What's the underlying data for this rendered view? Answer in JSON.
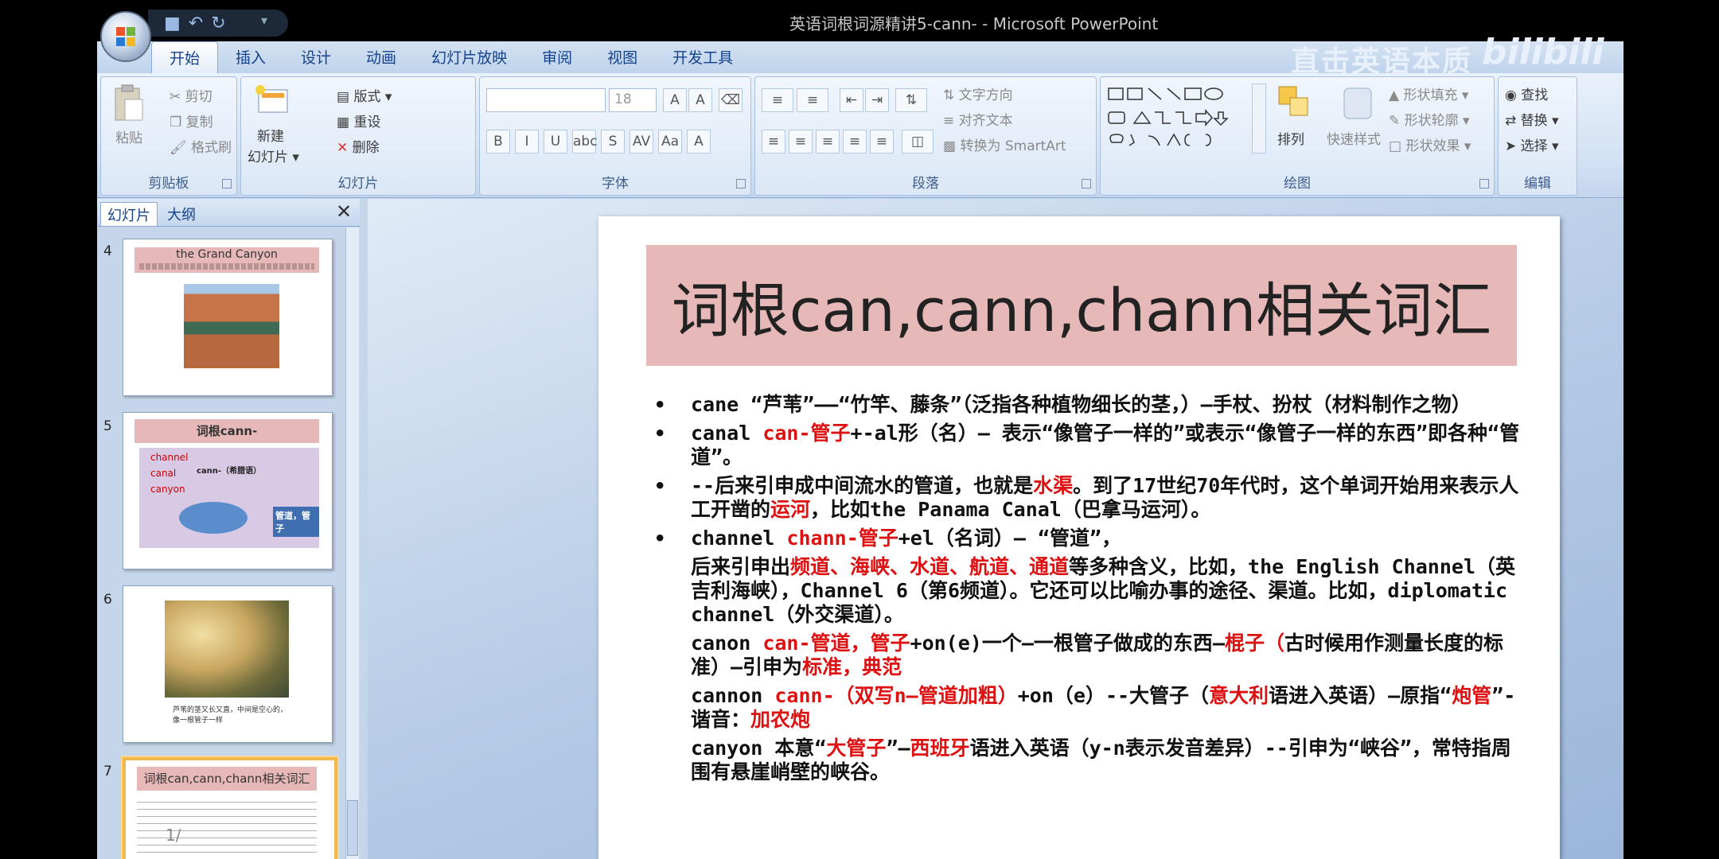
{
  "window": {
    "title": "英语词根词源精讲5-cann-  - Microsoft PowerPoint"
  },
  "ribbon_tabs": [
    "开始",
    "插入",
    "设计",
    "动画",
    "幻灯片放映",
    "审阅",
    "视图",
    "开发工具"
  ],
  "overlay": {
    "watermark": "直击英语本质",
    "bilibili": "bilibili"
  },
  "ribbon": {
    "clipboard": {
      "paste": "粘贴",
      "cut": "剪切",
      "copy": "复制",
      "format_painter": "格式刷",
      "label": "剪贴板"
    },
    "slides": {
      "new_slide": "新建",
      "new_slide2": "幻灯片",
      "layout": "版式",
      "reset": "重设",
      "delete": "删除",
      "label": "幻灯片"
    },
    "font": {
      "size": "18",
      "label": "字体",
      "buttons": [
        "B",
        "I",
        "U",
        "abc",
        "S",
        "AV",
        "Aa",
        "A"
      ]
    },
    "paragraph": {
      "text_direction": "文字方向",
      "align_text": "对齐文本",
      "smartart": "转换为 SmartArt",
      "label": "段落"
    },
    "drawing": {
      "arrange": "排列",
      "quick_styles": "快速样式",
      "shape_fill": "形状填充",
      "shape_outline": "形状轮廓",
      "shape_effects": "形状效果",
      "label": "绘图"
    },
    "editing": {
      "find": "查找",
      "replace": "替换",
      "select": "选择",
      "label": "编辑"
    }
  },
  "panel": {
    "tab_slides": "幻灯片",
    "tab_outline": "大纲"
  },
  "thumbnails": [
    {
      "num": "4",
      "title": "the Grand Canyon"
    },
    {
      "num": "5",
      "title": "词根cann-",
      "words": [
        "channel",
        "canal",
        "canyon"
      ],
      "root": "cann-（希腊语）",
      "box": "管道，管子"
    },
    {
      "num": "6",
      "caption": "芦苇的茎又长又直，中间是空心的，像一根管子一样"
    },
    {
      "num": "7",
      "title": "词根can,cann,chann相关词汇"
    }
  ],
  "slide": {
    "title": "词根can,cann,chann相关词汇",
    "bullets": [
      {
        "bullet": "•",
        "parts": [
          {
            "t": " cane “芦苇”——“竹竿、藤条”（泛指各种植物细长的茎，）—手杖、扮杖（材料制作之物）"
          }
        ]
      },
      {
        "bullet": "•",
        "parts": [
          {
            "t": " canal  "
          },
          {
            "t": "can-管子",
            "red": true
          },
          {
            "t": "+-al形（名）— 表示“像管子一样的”或表示“像管子一样的东西”即各种“管道”。"
          }
        ]
      },
      {
        "bullet": "•",
        "parts": [
          {
            "t": "--后来引申成中间流水的管道，也就是"
          },
          {
            "t": "水渠",
            "red": true
          },
          {
            "t": "。到了17世纪70年代时，这个单词开始用来表示人工开凿的"
          },
          {
            "t": "运河",
            "red": true
          },
          {
            "t": "，比如the Panama Canal（巴拿马运河）。"
          }
        ]
      },
      {
        "bullet": "•",
        "parts": [
          {
            "t": "channel "
          },
          {
            "t": "chann-管子",
            "red": true
          },
          {
            "t": "+el（名词）— “管道”，"
          }
        ]
      },
      {
        "bullet": "",
        "parts": [
          {
            "t": "  后来引申出"
          },
          {
            "t": "频道、海峡、水道、航道、通道",
            "red": true
          },
          {
            "t": "等多种含义，比如，the English Channel（英吉利海峡），Channel 6（第6频道）。它还可以比喻办事的途径、渠道。比如，diplomatic channel（外交渠道）。"
          }
        ]
      },
      {
        "bullet": "",
        "parts": [
          {
            "t": "canon "
          },
          {
            "t": "can-管道，管子",
            "red": true
          },
          {
            "t": "+on(e)一个—一根管子做成的东西—"
          },
          {
            "t": "棍子（",
            "red": true
          },
          {
            "t": "古时候用作测量长度的标准）—引申为"
          },
          {
            "t": "标准，典范",
            "red": true
          }
        ]
      },
      {
        "bullet": "",
        "parts": [
          {
            "t": " cannon  "
          },
          {
            "t": "cann-（双写n—管道加粗）",
            "red": true
          },
          {
            "t": "+on（e）--大管子（"
          },
          {
            "t": "意大利",
            "red": true
          },
          {
            "t": "语进入英语）—原指“"
          },
          {
            "t": "炮管",
            "red": true
          },
          {
            "t": "”-谐音："
          },
          {
            "t": "加农炮",
            "red": true
          }
        ]
      },
      {
        "bullet": "",
        "parts": [
          {
            "t": " canyon 本意“"
          },
          {
            "t": "大管子",
            "red": true
          },
          {
            "t": "”—"
          },
          {
            "t": "西班牙",
            "red": true
          },
          {
            "t": "语进入英语（y-n表示发音差异）--引申为“峡谷”，常特指周围有悬崖峭壁的峡谷。"
          }
        ]
      }
    ]
  },
  "status": {
    "text": "1/"
  },
  "colors": {
    "accent_red": "#d11111",
    "title_bar_pink": "#e6b9b8",
    "ribbon_blue": "#15428b"
  }
}
